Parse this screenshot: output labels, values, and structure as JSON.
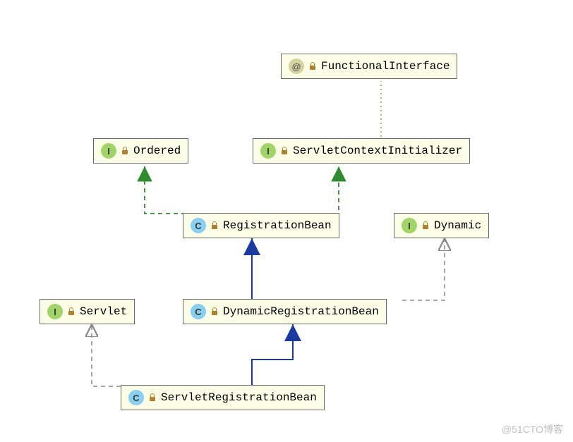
{
  "nodes": {
    "functionalInterface": {
      "label": "FunctionalInterface",
      "kind": "annotation"
    },
    "ordered": {
      "label": "Ordered",
      "kind": "interface"
    },
    "servletContextInitializer": {
      "label": "ServletContextInitializer",
      "kind": "interface"
    },
    "registrationBean": {
      "label": "RegistrationBean",
      "kind": "class"
    },
    "dynamic": {
      "label": "Dynamic",
      "kind": "interface"
    },
    "servlet": {
      "label": "Servlet",
      "kind": "interface"
    },
    "dynamicRegistrationBean": {
      "label": "DynamicRegistrationBean",
      "kind": "class"
    },
    "servletRegistrationBean": {
      "label": "ServletRegistrationBean",
      "kind": "class"
    }
  },
  "icon_letters": {
    "interface": "I",
    "class": "C",
    "annotation": "@"
  },
  "edges": [
    {
      "from": "registrationBean",
      "to": "ordered",
      "style": "dashed-green",
      "type": "generalization"
    },
    {
      "from": "registrationBean",
      "to": "servletContextInitializer",
      "style": "dashed-green",
      "type": "generalization"
    },
    {
      "from": "servletContextInitializer",
      "to": "functionalInterface",
      "style": "dotted-gray",
      "type": "annotation"
    },
    {
      "from": "dynamicRegistrationBean",
      "to": "registrationBean",
      "style": "solid-blue",
      "type": "generalization"
    },
    {
      "from": "dynamicRegistrationBean",
      "to": "dynamic",
      "style": "dashed-gray",
      "type": "generalization"
    },
    {
      "from": "servletRegistrationBean",
      "to": "dynamicRegistrationBean",
      "style": "solid-blue",
      "type": "generalization"
    },
    {
      "from": "servletRegistrationBean",
      "to": "servlet",
      "style": "dashed-gray",
      "type": "generalization"
    }
  ],
  "watermark": "@51CTO博客"
}
